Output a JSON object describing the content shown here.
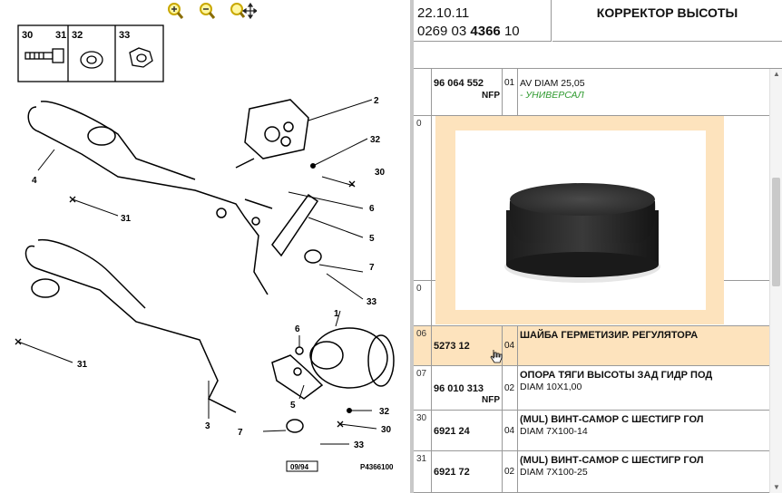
{
  "toolbar": {
    "zoom_in": "zoom-in-icon",
    "zoom_out": "zoom-out-icon",
    "zoom_pan": "zoom-pan-icon"
  },
  "drawing": {
    "legend": [
      {
        "label": "30",
        "label2": "31"
      },
      {
        "label": "32"
      },
      {
        "label": "33"
      }
    ],
    "callouts": [
      "1",
      "2",
      "3",
      "4",
      "5",
      "5",
      "6",
      "6",
      "7",
      "7",
      "30",
      "30",
      "31",
      "31",
      "32",
      "32",
      "33",
      "33"
    ],
    "date_stamp": "09/94",
    "drawing_code": "P4366100"
  },
  "header": {
    "date": "22.10.11",
    "code_prefix": "0269 03",
    "code_bold": "4366",
    "code_suffix": "10",
    "title": "КОРРЕКТОР ВЫСОТЫ"
  },
  "rows": [
    {
      "idx": "",
      "ref": "96 064 552",
      "nfp": "NFP",
      "qty": "01",
      "desc1": "AV DIAM 25,05",
      "desc2": "- УНИВЕРСАЛ",
      "desc2_green": true
    },
    {
      "idx": "0",
      "ref": "",
      "nfp": "",
      "qty": "",
      "desc1": "",
      "desc2": ""
    },
    {
      "idx": "0",
      "ref": "",
      "nfp": "",
      "qty": "",
      "desc1": "",
      "desc2": ""
    },
    {
      "idx": "06",
      "ref": "5273 12",
      "nfp": "",
      "qty": "04",
      "desc1": "ШАЙБА ГЕРМЕТИЗИР. РЕГУЛЯТОРА",
      "desc2": "",
      "selected": true
    },
    {
      "idx": "07",
      "ref": "96 010 313",
      "nfp": "NFP",
      "qty": "02",
      "desc1": "ОПОРА ТЯГИ ВЫСОТЫ ЗАД ГИДР ПОД",
      "desc2": "DIAM 10X1,00"
    },
    {
      "idx": "30",
      "ref": "6921 24",
      "nfp": "",
      "qty": "04",
      "desc1": "(MUL) ВИНТ-САМОР С ШЕСТИГР ГОЛ",
      "desc2": "DIAM 7X100-14"
    },
    {
      "idx": "31",
      "ref": "6921 72",
      "nfp": "",
      "qty": "02",
      "desc1": "(MUL) ВИНТ-САМОР С ШЕСТИГР ГОЛ",
      "desc2": "DIAM 7X100-25"
    }
  ],
  "photo": {
    "alt": "rubber-bushing-photo"
  },
  "colors": {
    "selected_row": "#fde3bd",
    "universal_text": "#2f9a2f",
    "zoom_icon": "#e0c000"
  }
}
